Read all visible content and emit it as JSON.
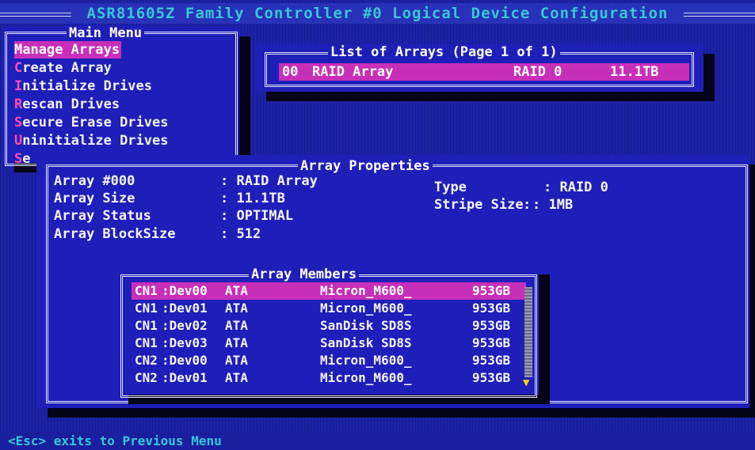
{
  "title": "ASR81605Z Family Controller #0 Logical Device Configuration",
  "main_menu": {
    "title": "Main Menu",
    "items": [
      {
        "hot": "M",
        "rest": "anage Arrays",
        "selected": true
      },
      {
        "hot": "C",
        "rest": "reate Array",
        "selected": false
      },
      {
        "hot": "I",
        "rest": "nitialize Drives",
        "selected": false
      },
      {
        "hot": "R",
        "rest": "escan Drives",
        "selected": false
      },
      {
        "hot": "S",
        "rest": "ecure Erase Drives",
        "selected": false
      },
      {
        "hot": "U",
        "rest": "ninitialize Drives",
        "selected": false
      },
      {
        "hot": "S",
        "rest": "e",
        "selected": false
      }
    ]
  },
  "array_list": {
    "title": "List of Arrays (Page 1 of 1)",
    "rows": [
      {
        "num": "00",
        "name": "RAID Array",
        "level": "RAID 0",
        "size": "11.1TB"
      }
    ]
  },
  "properties": {
    "title": "Array Properties",
    "fields": [
      {
        "label": "Array #000",
        "value": ": RAID Array"
      },
      {
        "label": "Array Size",
        "value": ": 11.1TB"
      },
      {
        "label": "Array Status",
        "value": ": OPTIMAL"
      },
      {
        "label": "Array BlockSize",
        "value": ": 512"
      }
    ],
    "type_label": "Type",
    "type_value": ": RAID 0",
    "stripe_label": "Stripe Size",
    "stripe_value": ": 1MB"
  },
  "members": {
    "title": "Array Members",
    "rows": [
      {
        "cn": "CN1",
        "dev": ":Dev00",
        "iface": "ATA",
        "model": "Micron_M600_",
        "size": "953GB"
      },
      {
        "cn": "CN1",
        "dev": ":Dev01",
        "iface": "ATA",
        "model": "Micron_M600_",
        "size": "953GB"
      },
      {
        "cn": "CN1",
        "dev": ":Dev02",
        "iface": "ATA",
        "model": "SanDisk SD8S",
        "size": "953GB"
      },
      {
        "cn": "CN1",
        "dev": ":Dev03",
        "iface": "ATA",
        "model": "SanDisk SD8S",
        "size": "953GB"
      },
      {
        "cn": "CN2",
        "dev": ":Dev00",
        "iface": "ATA",
        "model": "Micron_M600_",
        "size": "953GB"
      },
      {
        "cn": "CN2",
        "dev": ":Dev01",
        "iface": "ATA",
        "model": "Micron_M600_",
        "size": "953GB"
      }
    ]
  },
  "footer": "<Esc> exits to Previous Menu",
  "colors": {
    "background": "#1c22a8",
    "highlight": "#c82fb9",
    "title": "#36c7d8",
    "hotkey": "#ff4fb0"
  }
}
